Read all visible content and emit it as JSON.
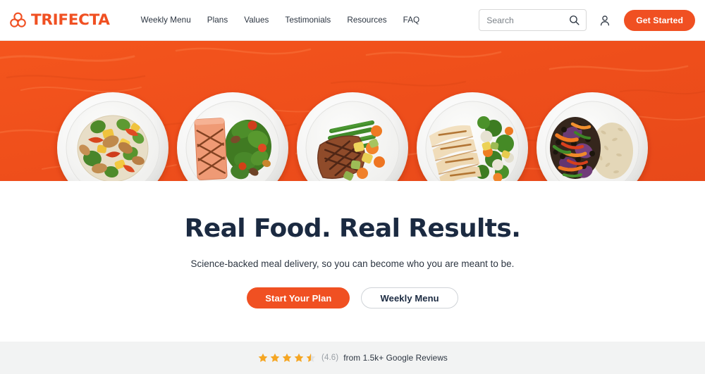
{
  "header": {
    "logo": {
      "icon": "trifecta-trefoil-logo-icon",
      "wordmark": "TRIFECTA",
      "color": "#f05022"
    },
    "nav": [
      {
        "label": "Weekly Menu"
      },
      {
        "label": "Plans"
      },
      {
        "label": "Values"
      },
      {
        "label": "Testimonials"
      },
      {
        "label": "Resources"
      },
      {
        "label": "FAQ"
      }
    ],
    "search": {
      "placeholder": "Search",
      "value": "",
      "icon": "search-icon"
    },
    "account": {
      "icon": "user-account-icon"
    },
    "cta": {
      "label": "Get Started",
      "color": "#f05022"
    }
  },
  "hero_banner": {
    "background_color": "#f2511b",
    "plates": [
      {
        "name": "chicken-pineapple-stir-fry-plate",
        "alt": "Chicken and pineapple stir fry with broccoli over rice"
      },
      {
        "name": "grilled-salmon-plate",
        "alt": "Grilled salmon with kale and roasted vegetables"
      },
      {
        "name": "grilled-steak-plate",
        "alt": "Grilled steak with green beans, carrots and squash"
      },
      {
        "name": "grilled-chicken-breast-plate",
        "alt": "Sliced grilled chicken with broccoli and cauliflower"
      },
      {
        "name": "black-bean-veggie-rice-plate",
        "alt": "Black beans, purple cabbage and peppers with brown rice"
      }
    ]
  },
  "hero": {
    "title": "Real Food. Real Results.",
    "subtitle": "Science-backed meal delivery, so you can become who you are meant to be.",
    "primary_button": "Start Your Plan",
    "secondary_button": "Weekly Menu",
    "title_color": "#1b2a41"
  },
  "reviews": {
    "rating": "(4.6)",
    "rating_number": 4.6,
    "stars_total": 5,
    "stars_filled": 4,
    "stars_half": 1,
    "star_color": "#f5a623",
    "text": "from 1.5k+ Google Reviews",
    "background_color": "#f2f3f3"
  }
}
